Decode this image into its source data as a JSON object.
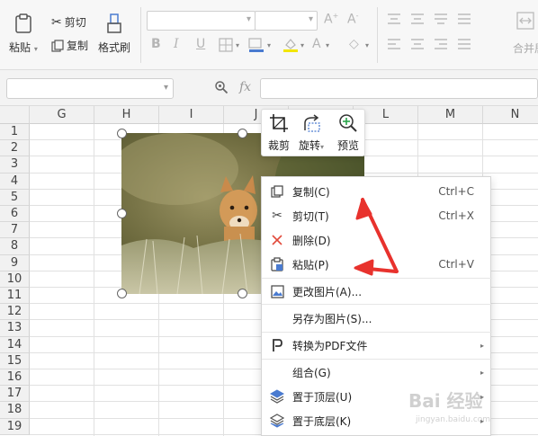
{
  "ribbon": {
    "paste": "粘贴",
    "cut": "剪切",
    "copy": "复制",
    "format_painter": "格式刷",
    "merge": "合并居"
  },
  "formula_bar": {
    "fx": "fx",
    "name_box": "",
    "formula": ""
  },
  "sheet": {
    "columns": [
      "G",
      "H",
      "I",
      "J",
      "K",
      "L",
      "M",
      "N"
    ],
    "rows": [
      "1",
      "2",
      "3",
      "4",
      "5",
      "6",
      "7",
      "8",
      "9",
      "10",
      "11",
      "12",
      "13",
      "14",
      "15",
      "16",
      "17",
      "18",
      "19"
    ]
  },
  "float_toolbar": {
    "crop": "裁剪",
    "rotate": "旋转",
    "preview": "预览"
  },
  "context_menu": {
    "items": [
      {
        "label": "复制(C)",
        "shortcut": "Ctrl+C"
      },
      {
        "label": "剪切(T)",
        "shortcut": "Ctrl+X"
      },
      {
        "label": "删除(D)",
        "shortcut": ""
      },
      {
        "label": "粘贴(P)",
        "shortcut": "Ctrl+V"
      },
      {
        "label": "更改图片(A)...",
        "shortcut": ""
      },
      {
        "label": "另存为图片(S)...",
        "shortcut": ""
      },
      {
        "label": "转换为PDF文件",
        "shortcut": ""
      },
      {
        "label": "组合(G)",
        "shortcut": ""
      },
      {
        "label": "置于顶层(U)",
        "shortcut": ""
      },
      {
        "label": "置于底层(K)",
        "shortcut": ""
      }
    ]
  },
  "watermark": {
    "brand": "Bai 经验",
    "url": "jingyan.baidu.com"
  },
  "colors": {
    "arrow_red": "#e8322d",
    "ribbon_bg": "#f7f7f7",
    "grid_line": "#e1e1e1",
    "header_bg": "#f1f1f1"
  }
}
